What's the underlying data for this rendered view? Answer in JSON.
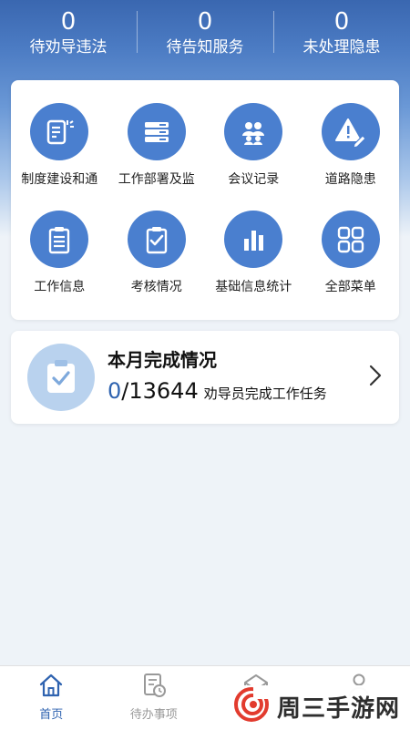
{
  "stats": [
    {
      "value": "0",
      "label": "待劝导违法"
    },
    {
      "value": "0",
      "label": "待告知服务"
    },
    {
      "value": "0",
      "label": "未处理隐患"
    }
  ],
  "menu": [
    {
      "label": "制度建设和通",
      "icon": "document-edit-icon"
    },
    {
      "label": "工作部署及监",
      "icon": "server-stack-icon"
    },
    {
      "label": "会议记录",
      "icon": "meeting-people-icon"
    },
    {
      "label": "道路隐患",
      "icon": "warning-edit-icon"
    },
    {
      "label": "工作信息",
      "icon": "clipboard-list-icon"
    },
    {
      "label": "考核情况",
      "icon": "clipboard-check-icon"
    },
    {
      "label": "基础信息统计",
      "icon": "bar-chart-icon"
    },
    {
      "label": "全部菜单",
      "icon": "grid-menu-icon"
    }
  ],
  "task": {
    "title": "本月完成情况",
    "done": "0",
    "total": "/13644",
    "desc": "劝导员完成工作任务"
  },
  "tabs": [
    {
      "label": "首页",
      "icon": "home-icon",
      "active": true
    },
    {
      "label": "待办事项",
      "icon": "todo-clock-icon",
      "active": false
    },
    {
      "label": "",
      "icon": "envelope-icon",
      "active": false
    },
    {
      "label": "",
      "icon": "user-icon",
      "active": false
    }
  ],
  "watermark": {
    "text": "周三手游网"
  },
  "colors": {
    "primary": "#4a7fcf",
    "accent": "#2f63b0",
    "background": "#eef3f8"
  }
}
